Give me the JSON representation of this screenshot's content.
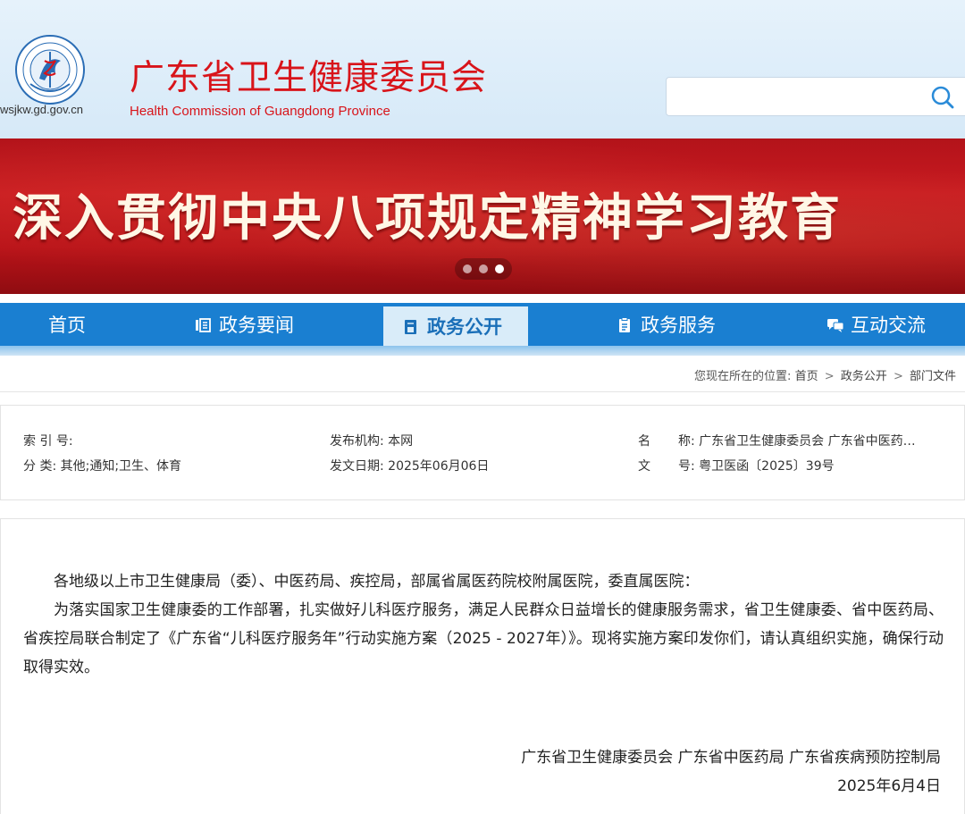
{
  "header": {
    "title_cn": "广东省卫生健康委员会",
    "title_en": "Health Commission of Guangdong Province",
    "domain": "wsjkw.gd.gov.cn",
    "logo_icon": "emblem-logo-icon"
  },
  "search": {
    "placeholder": "",
    "icon": "search-icon"
  },
  "banner": {
    "text": "深入贯彻中央八项规定精神学习教育",
    "slides": 3,
    "active_slide": 3
  },
  "nav": {
    "items": [
      {
        "label": "首页",
        "icon": ""
      },
      {
        "label": "政务要闻",
        "icon": "news-list-icon"
      },
      {
        "label": "政务公开",
        "icon": "document-icon"
      },
      {
        "label": "政务服务",
        "icon": "clipboard-icon"
      },
      {
        "label": "互动交流",
        "icon": "chat-icon"
      }
    ],
    "active_index": 2
  },
  "breadcrumb": {
    "prefix": "您现在所在的位置:",
    "items": [
      "首页",
      "政务公开",
      "部门文件"
    ],
    "separator": ">"
  },
  "meta": {
    "index_no": "索 引 号:",
    "category": "分 类: 其他;通知;卫生、体育",
    "publisher": "发布机构: 本网",
    "publish_date": "发文日期: 2025年06月06日",
    "name_label": "名",
    "name_value": "称: 广东省卫生健康委员会 广东省中医药…",
    "doc_label": "文",
    "doc_value": "号: 粤卫医函〔2025〕39号"
  },
  "content": {
    "salutation": "各地级以上市卫生健康局（委）、中医药局、疾控局，部属省属医药院校附属医院，委直属医院：",
    "body": "为落实国家卫生健康委的工作部署，扎实做好儿科医疗服务，满足人民群众日益增长的健康服务需求，省卫生健康委、省中医药局、省疾控局联合制定了《广东省“儿科医疗服务年”行动实施方案（2025 - 2027年）》。现将实施方案印发你们，请认真组织实施，确保行动取得实效。",
    "signers": "广东省卫生健康委员会  广东省中医药局  广东省疾病预防控制局",
    "date": "2025年6月4日"
  },
  "colors": {
    "brand_red": "#d8141a",
    "nav_blue": "#1a7fd1",
    "nav_active_bg": "#d9ecf9",
    "banner_red": "#c81a20"
  }
}
